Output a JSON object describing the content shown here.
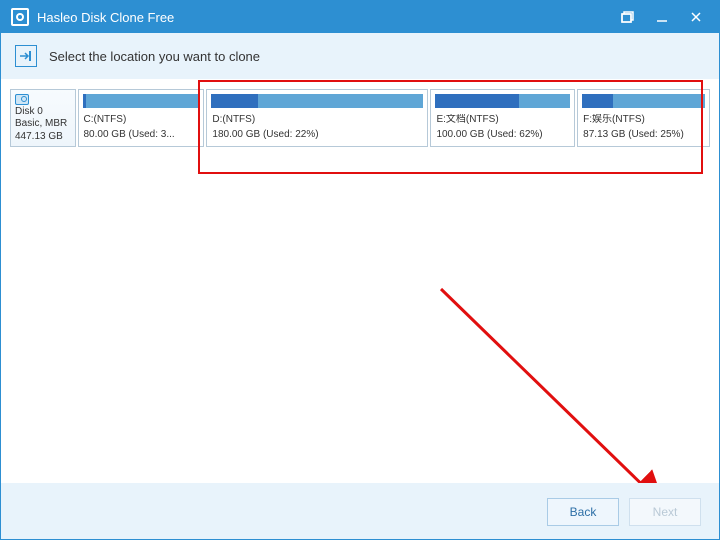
{
  "window": {
    "title": "Hasleo Disk Clone Free"
  },
  "instruction": {
    "text": "Select the location you want to clone"
  },
  "disk": {
    "name": "Disk 0",
    "type": "Basic, MBR",
    "size": "447.13 GB"
  },
  "partitions": [
    {
      "label": "C:(NTFS)",
      "detail": "80.00 GB (Used: 3...",
      "used_pct": 3
    },
    {
      "label": "D:(NTFS)",
      "detail": "180.00 GB (Used: 22%)",
      "used_pct": 22
    },
    {
      "label": "E:文档(NTFS)",
      "detail": "100.00 GB (Used: 62%)",
      "used_pct": 62
    },
    {
      "label": "F:娱乐(NTFS)",
      "detail": "87.13 GB (Used: 25%)",
      "used_pct": 25
    }
  ],
  "footer": {
    "back": "Back",
    "next": "Next"
  }
}
